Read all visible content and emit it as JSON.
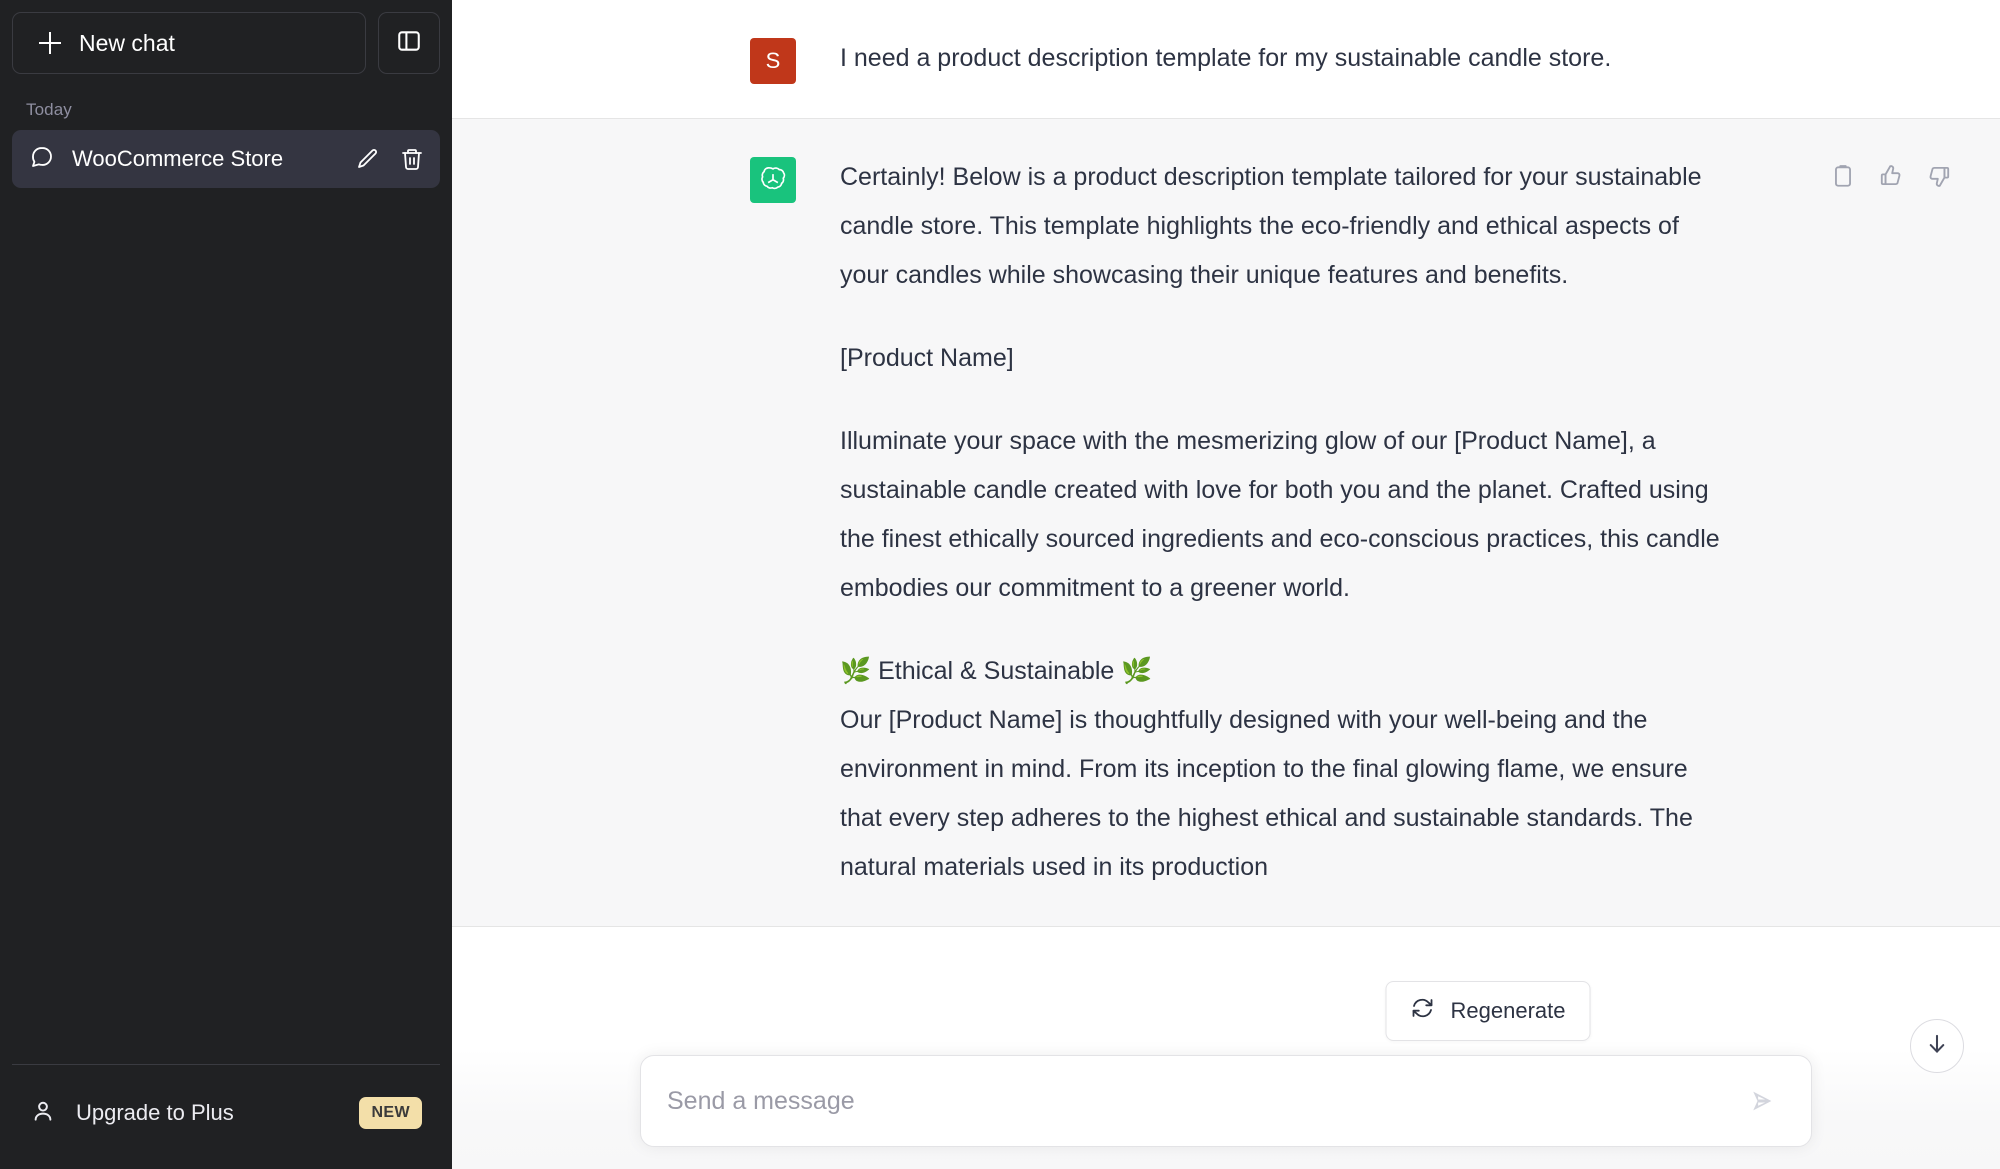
{
  "sidebar": {
    "new_chat_label": "New chat",
    "section_label": "Today",
    "chat_item": {
      "label": "WooCommerce Store"
    },
    "upgrade": {
      "label": "Upgrade to Plus",
      "badge": "NEW"
    }
  },
  "conversation": {
    "user_message": {
      "avatar_initial": "S",
      "text": "I need a product description template for my sustainable candle store."
    },
    "assistant_message": {
      "paragraphs": [
        "Certainly! Below is a product description template tailored for your sustainable candle store. This template highlights the eco-friendly and ethical aspects of your candles while showcasing their unique features and benefits.",
        "[Product Name]",
        "Illuminate your space with the mesmerizing glow of our [Product Name], a sustainable candle created with love for both you and the planet. Crafted using the finest ethically sourced ingredients and eco-conscious practices, this candle embodies our commitment to a greener world."
      ],
      "section_heading": "🌿 Ethical & Sustainable 🌿",
      "section_body": "Our [Product Name] is thoughtfully designed with your well-being and the environment in mind. From its inception to the final glowing flame, we ensure that every step adheres to the highest ethical and sustainable standards. The natural materials used in its production"
    }
  },
  "composer": {
    "placeholder": "Send a message",
    "value": ""
  },
  "actions": {
    "regenerate_label": "Regenerate"
  },
  "colors": {
    "sidebar_bg": "#202123",
    "chat_active_bg": "#343541",
    "user_avatar": "#c0371a",
    "assistant_avatar": "#19c37d",
    "assistant_bg": "#f7f7f8",
    "badge_bg": "#f3dfa9"
  }
}
